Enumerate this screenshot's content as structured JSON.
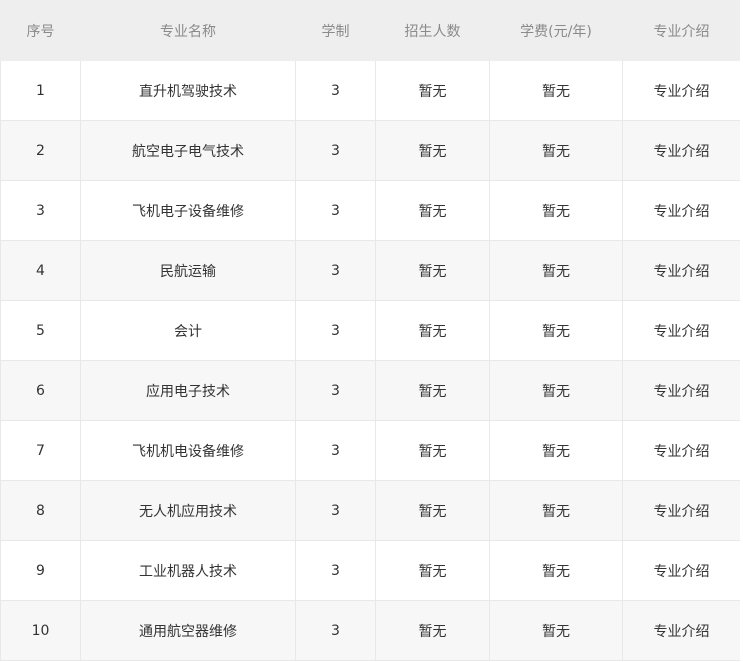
{
  "table": {
    "headers": [
      "序号",
      "专业名称",
      "学制",
      "招生人数",
      "学费(元/年)",
      "专业介绍"
    ],
    "rows": [
      {
        "index": "1",
        "name": "直升机驾驶技术",
        "duration": "3",
        "enrollment": "暂无",
        "tuition": "暂无",
        "intro": "专业介绍"
      },
      {
        "index": "2",
        "name": "航空电子电气技术",
        "duration": "3",
        "enrollment": "暂无",
        "tuition": "暂无",
        "intro": "专业介绍"
      },
      {
        "index": "3",
        "name": "飞机电子设备维修",
        "duration": "3",
        "enrollment": "暂无",
        "tuition": "暂无",
        "intro": "专业介绍"
      },
      {
        "index": "4",
        "name": "民航运输",
        "duration": "3",
        "enrollment": "暂无",
        "tuition": "暂无",
        "intro": "专业介绍"
      },
      {
        "index": "5",
        "name": "会计",
        "duration": "3",
        "enrollment": "暂无",
        "tuition": "暂无",
        "intro": "专业介绍"
      },
      {
        "index": "6",
        "name": "应用电子技术",
        "duration": "3",
        "enrollment": "暂无",
        "tuition": "暂无",
        "intro": "专业介绍"
      },
      {
        "index": "7",
        "name": "飞机机电设备维修",
        "duration": "3",
        "enrollment": "暂无",
        "tuition": "暂无",
        "intro": "专业介绍"
      },
      {
        "index": "8",
        "name": "无人机应用技术",
        "duration": "3",
        "enrollment": "暂无",
        "tuition": "暂无",
        "intro": "专业介绍"
      },
      {
        "index": "9",
        "name": "工业机器人技术",
        "duration": "3",
        "enrollment": "暂无",
        "tuition": "暂无",
        "intro": "专业介绍"
      },
      {
        "index": "10",
        "name": "通用航空器维修",
        "duration": "3",
        "enrollment": "暂无",
        "tuition": "暂无",
        "intro": "专业介绍"
      }
    ]
  }
}
